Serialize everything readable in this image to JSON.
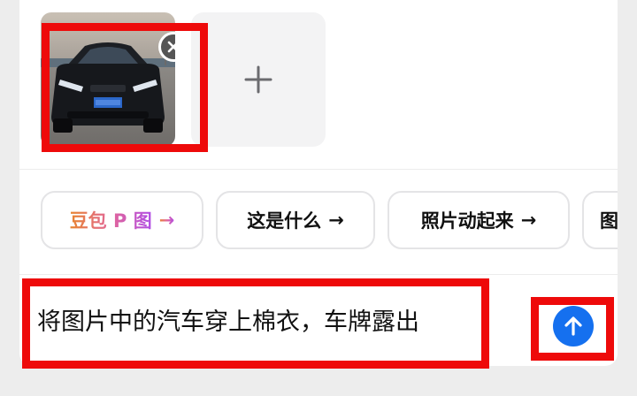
{
  "attachments": {
    "image_alt": "汽车照片",
    "remove_icon": "close-icon",
    "add_icon": "plus-icon"
  },
  "suggestions": [
    {
      "label": "豆包 P 图",
      "arrow": "→",
      "highlight": true
    },
    {
      "label": "这是什么",
      "arrow": "→",
      "highlight": false
    },
    {
      "label": "照片动起来",
      "arrow": "→",
      "highlight": false
    },
    {
      "label": "图",
      "arrow": "",
      "highlight": false
    }
  ],
  "composer": {
    "text": "将图片中的汽车穿上棉衣，车牌露出",
    "send_icon": "arrow-up-icon"
  },
  "colors": {
    "annotation_red": "#ee0a0a",
    "send_blue": "#1570ef",
    "chip_gradient": [
      "#e8852f",
      "#e2669a",
      "#b04de6"
    ]
  }
}
